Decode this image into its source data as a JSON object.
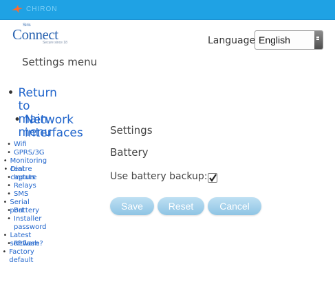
{
  "header": {
    "brand_text": "CHIRON",
    "logo_main": "Connect",
    "logo_small": "Siris",
    "logo_tagline": "Secure since 18"
  },
  "language": {
    "label": "Language:",
    "selected": "English"
  },
  "menu": {
    "title": "Settings menu",
    "primary": [
      {
        "id": "return",
        "lines": [
          "Return to",
          "main menu"
        ]
      },
      {
        "id": "network",
        "lines": [
          "Network",
          "interfaces"
        ]
      }
    ],
    "secondary": [
      {
        "id": "wifi",
        "lines": [
          "Wifi"
        ]
      },
      {
        "id": "gprs",
        "lines": [
          "GPRS/3G"
        ]
      },
      {
        "id": "monitoring",
        "lines": [
          "Monitoring centre"
        ]
      },
      {
        "id": "dial",
        "lines": [
          "Dial capture"
        ]
      },
      {
        "id": "inputs",
        "lines": [
          "Inputs"
        ]
      },
      {
        "id": "relays",
        "lines": [
          "Relays"
        ]
      },
      {
        "id": "sms",
        "lines": [
          "SMS"
        ]
      },
      {
        "id": "serial",
        "lines": [
          "Serial port"
        ]
      },
      {
        "id": "battery",
        "lines": [
          "Battery"
        ]
      },
      {
        "id": "installer",
        "lines": [
          "Installer",
          "password"
        ]
      },
      {
        "id": "software",
        "lines": [
          "Latest software?"
        ]
      },
      {
        "id": "reflash",
        "lines": [
          "Reflash"
        ]
      },
      {
        "id": "factory",
        "lines": [
          "Factory default"
        ]
      }
    ]
  },
  "main": {
    "title": "Settings",
    "subtitle": "Battery",
    "backup_label": "Use battery backup:",
    "backup_checked": true
  },
  "buttons": {
    "save": "Save",
    "reset": "Reset",
    "cancel": "Cancel"
  },
  "colors": {
    "topbar": "#1fa2e4",
    "link": "#2266cc",
    "button": "#a8d3ee"
  }
}
